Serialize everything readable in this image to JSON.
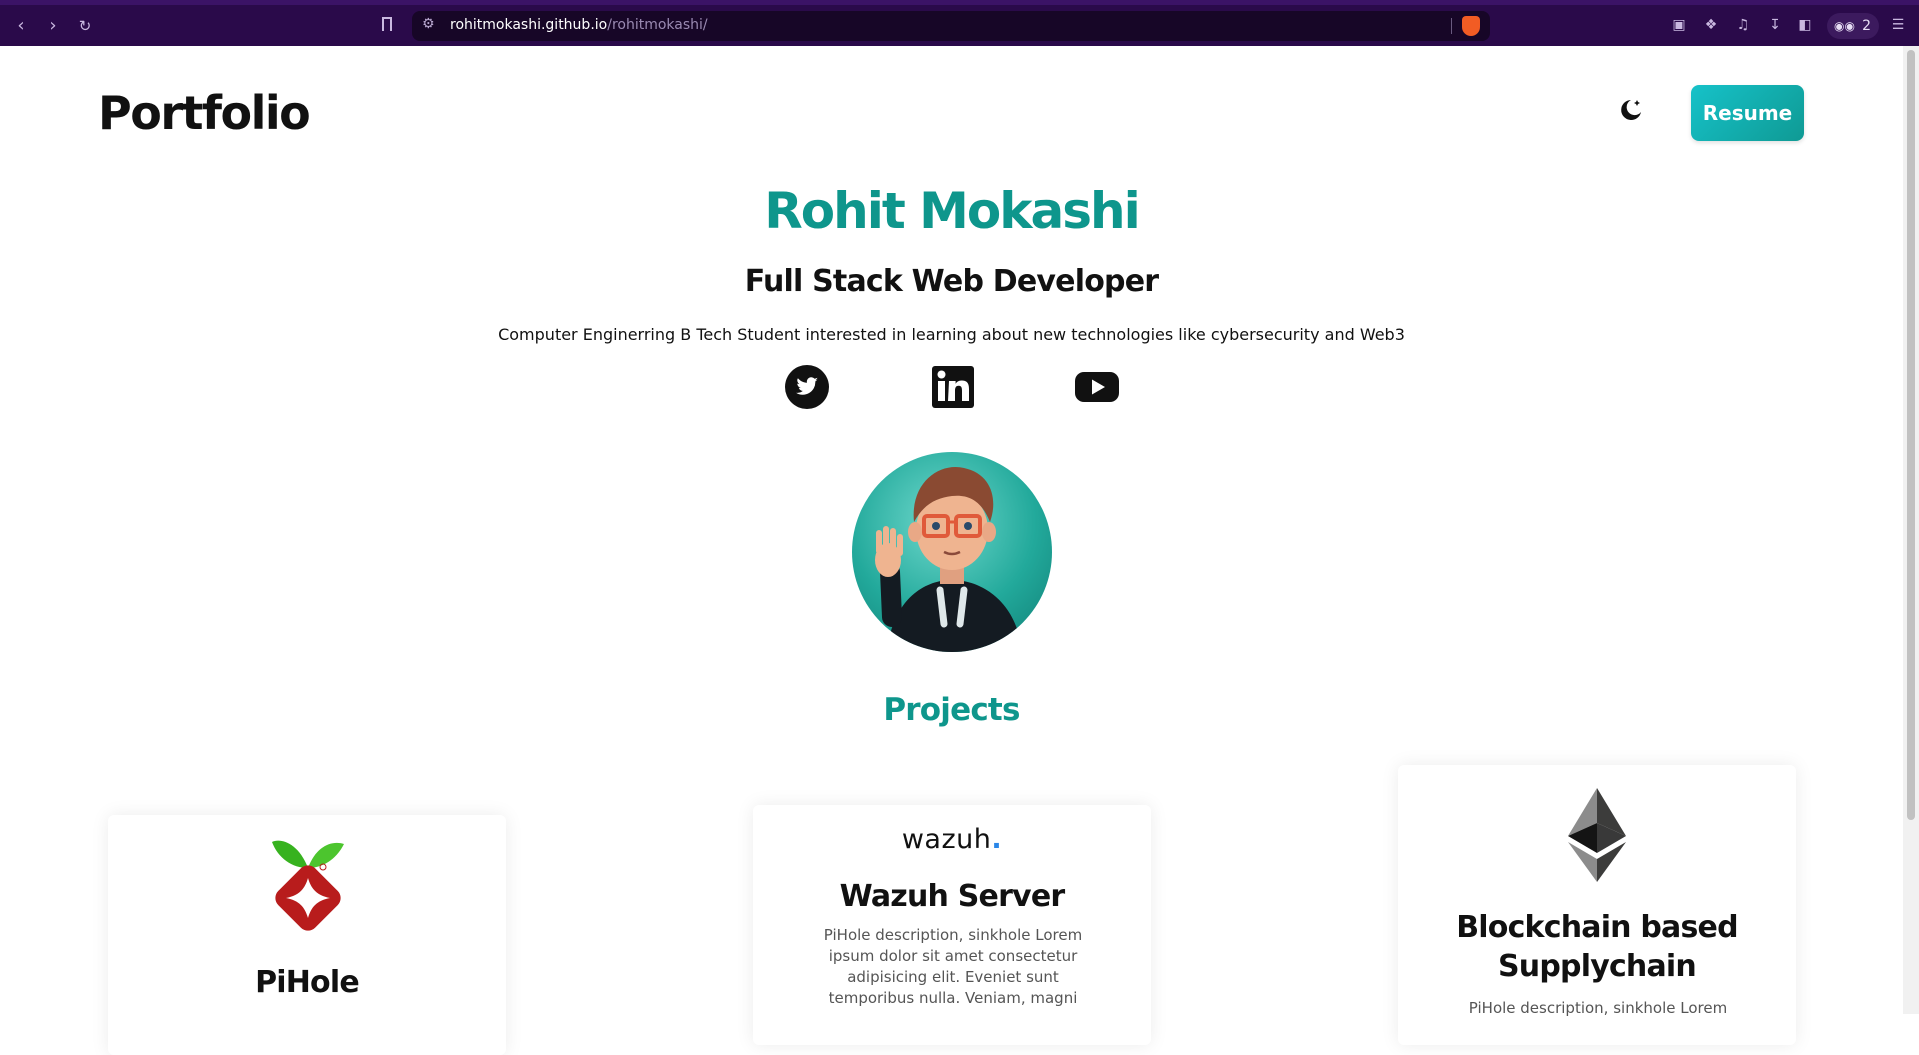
{
  "browser": {
    "url_host": "rohitmokashi.github.io",
    "url_path": "/rohitmokashi/",
    "wallet_count": "2",
    "icons": [
      "back-icon",
      "forward-icon",
      "reload-icon",
      "bookmark-icon",
      "site-settings-icon",
      "brave-shields-icon",
      "tab-icon",
      "extensions-icon",
      "media-icon",
      "downloads-icon",
      "sidebar-icon",
      "wallet-icon",
      "menu-icon"
    ]
  },
  "header": {
    "logo": "Portfolio",
    "theme_toggle_icon": "moon-icon",
    "resume_label": "Resume"
  },
  "hero": {
    "name": "Rohit Mokashi",
    "role": "Full Stack Web Developer",
    "bio": "Computer Enginerring B Tech Student interested in learning about new technologies like cybersecurity and Web3",
    "socials": [
      "twitter-icon",
      "linkedin-icon",
      "youtube-icon"
    ]
  },
  "projects": {
    "title": "Projects",
    "cards": [
      {
        "title": "PiHole",
        "logo": "pihole-logo"
      },
      {
        "title": "Wazuh Server",
        "logo_text": "wazuh",
        "logo_dot": ".",
        "description_lines": [
          "PiHole description, sinkhole Lorem",
          "ipsum dolor sit amet consectetur",
          "adipisicing elit. Eveniet sunt",
          "temporibus nulla. Veniam, magni"
        ]
      },
      {
        "title_lines": [
          "Blockchain based",
          "Supplychain"
        ],
        "logo": "ethereum-logo",
        "description_lines": [
          "PiHole description, sinkhole Lorem"
        ]
      }
    ]
  },
  "colors": {
    "accent": "#0e968c",
    "button_gradient_start": "#16c2c9",
    "button_gradient_end": "#0f9a94",
    "chrome_bg": "#2a0a4a"
  }
}
